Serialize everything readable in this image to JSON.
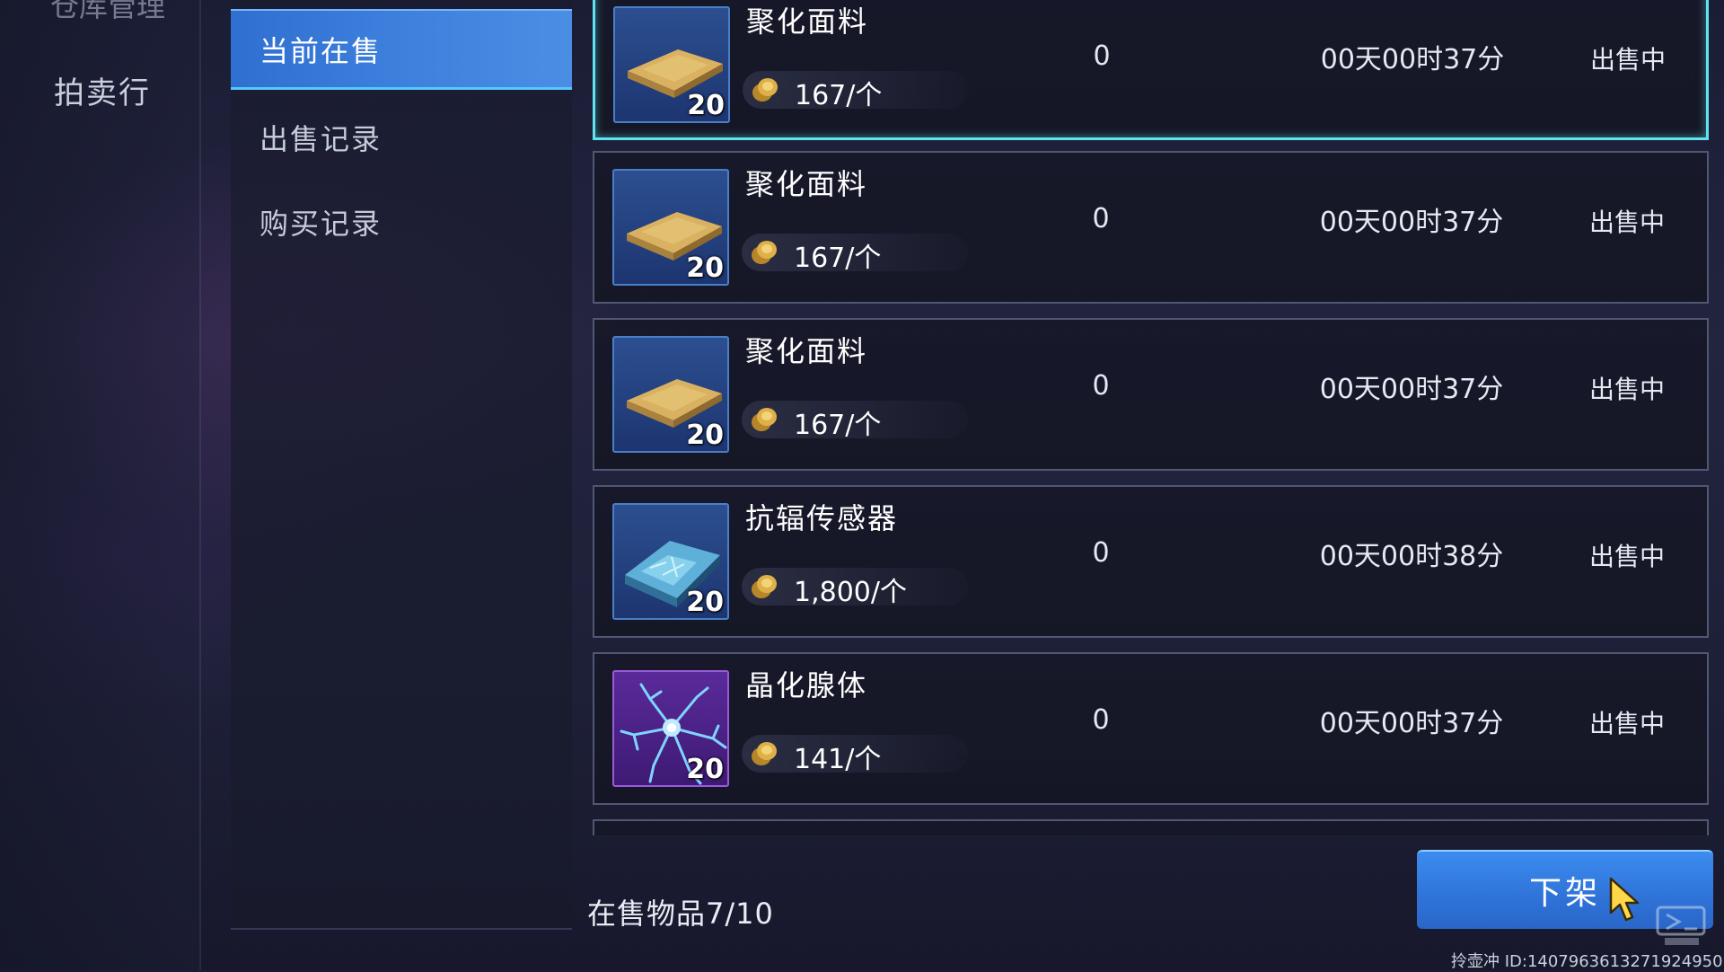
{
  "left_nav": {
    "top_label": "仓库管理",
    "item": "拍卖行"
  },
  "sub_menu": {
    "items": [
      {
        "label": "当前在售",
        "active": true
      },
      {
        "label": "出售记录",
        "active": false
      },
      {
        "label": "购买记录",
        "active": false
      }
    ]
  },
  "items": [
    {
      "name": "聚化面料",
      "qty": "20",
      "price": "167/个",
      "count": "0",
      "time": "00天00时37分",
      "status": "出售中",
      "icon": "fabric-icon"
    },
    {
      "name": "聚化面料",
      "qty": "20",
      "price": "167/个",
      "count": "0",
      "time": "00天00时37分",
      "status": "出售中",
      "icon": "fabric-icon"
    },
    {
      "name": "聚化面料",
      "qty": "20",
      "price": "167/个",
      "count": "0",
      "time": "00天00时37分",
      "status": "出售中",
      "icon": "fabric-icon"
    },
    {
      "name": "抗辐传感器",
      "qty": "20",
      "price": "1,800/个",
      "count": "0",
      "time": "00天00时38分",
      "status": "出售中",
      "icon": "sensor-icon"
    },
    {
      "name": "晶化腺体",
      "qty": "20",
      "price": "141/个",
      "count": "0",
      "time": "00天00时37分",
      "status": "出售中",
      "icon": "crystal-gland-icon"
    }
  ],
  "footer": {
    "on_sale_count": "在售物品7/10",
    "delist_button": "下架",
    "player_id": "拎壶冲 ID:1407963613271924950"
  },
  "colors": {
    "accent": "#3f82de",
    "selected_border": "#5fe3f0",
    "coin": "#d9a63a"
  }
}
